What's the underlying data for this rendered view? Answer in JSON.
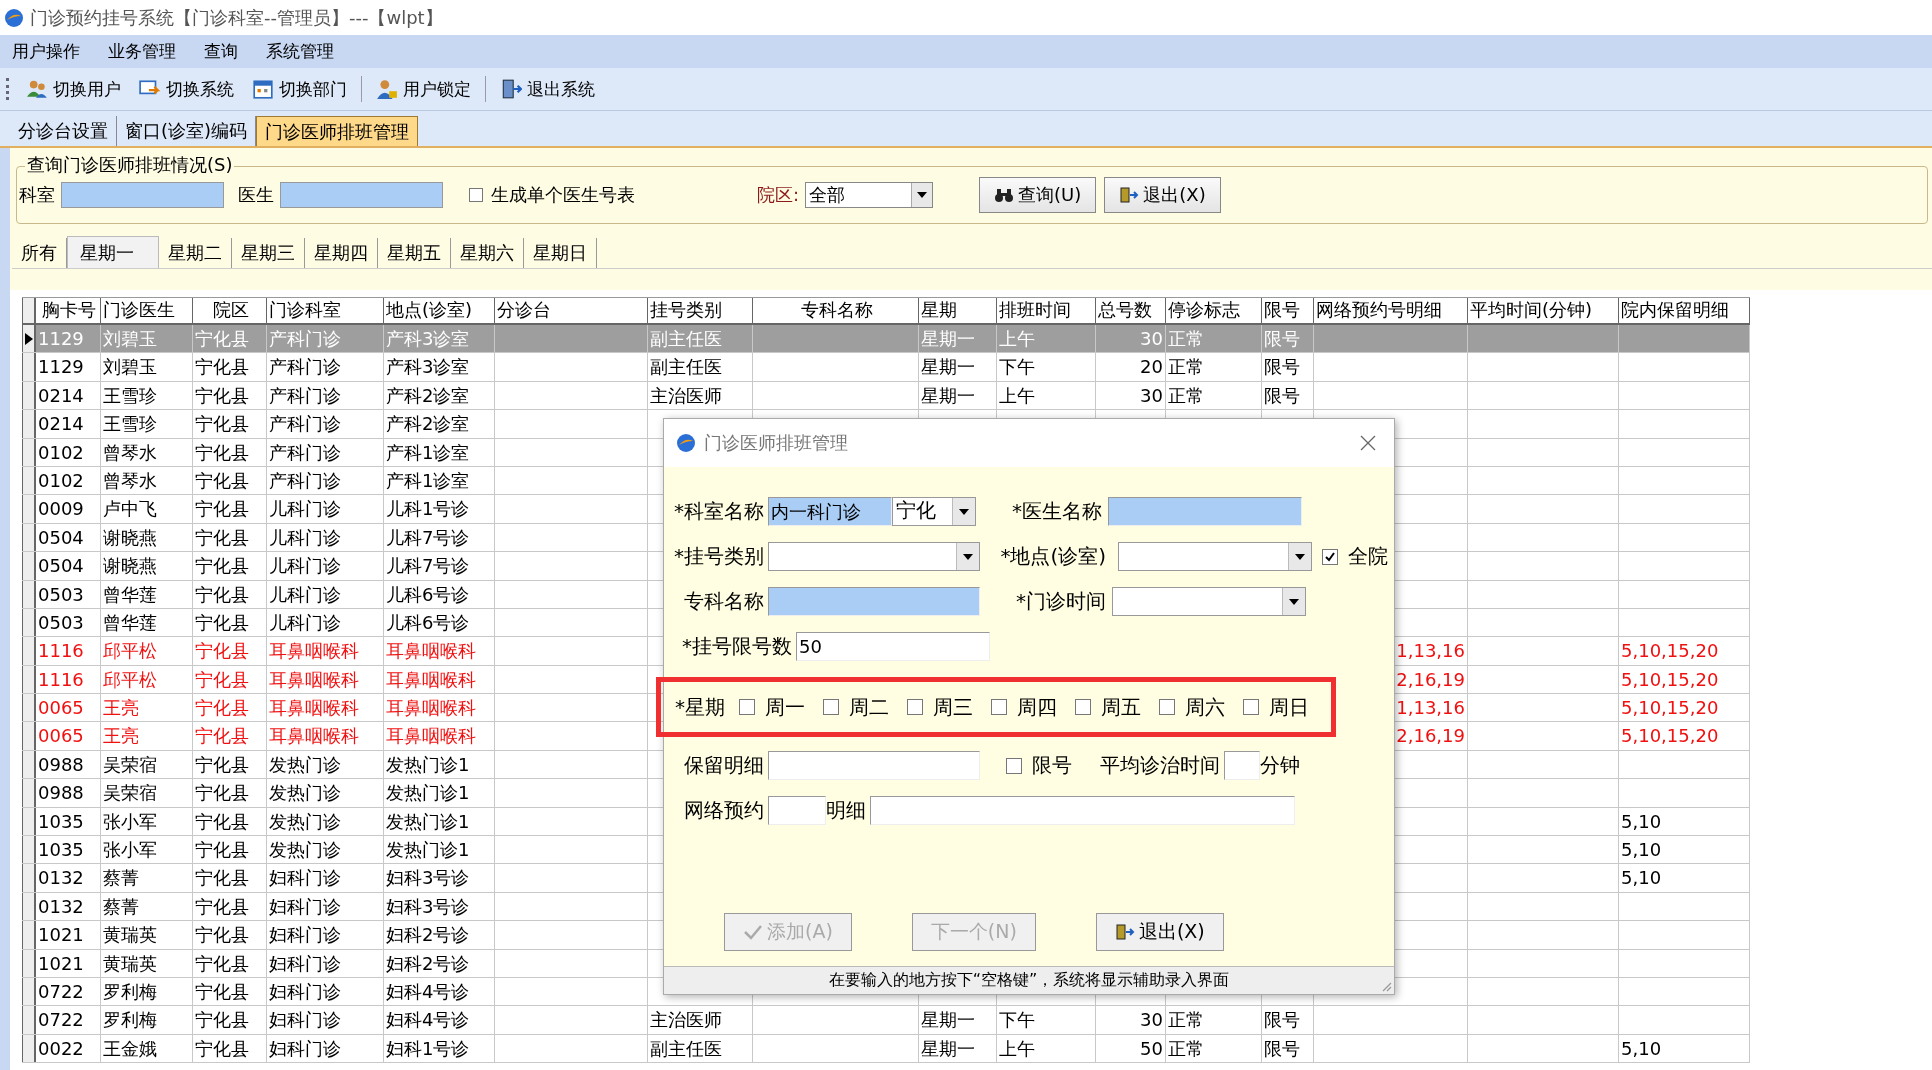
{
  "window": {
    "title": "门诊预约挂号系统【门诊科室--管理员】---【wlpt】"
  },
  "menu": [
    "用户操作",
    "业务管理",
    "查询",
    "系统管理"
  ],
  "toolbar": [
    "切换用户",
    "切换系统",
    "切换部门",
    "用户锁定",
    "退出系统"
  ],
  "tabs": [
    {
      "label": "分诊台设置",
      "selected": false
    },
    {
      "label": "窗口(诊室)编码",
      "selected": false
    },
    {
      "label": "门诊医师排班管理",
      "selected": true
    }
  ],
  "query": {
    "title": "查询门诊医师排班情况(S)",
    "dept_label": "科室",
    "doctor_label": "医生",
    "single": {
      "label": "生成单个医生号表",
      "checked": false
    },
    "campus_label": "院区:",
    "campus_value": "全部",
    "buttons": [
      "查询(U)",
      "退出(X)"
    ]
  },
  "day_tabs": [
    {
      "label": "所有",
      "selected": false
    },
    {
      "label": "星期一",
      "selected": true
    },
    {
      "label": "星期二",
      "selected": false
    },
    {
      "label": "星期三",
      "selected": false
    },
    {
      "label": "星期四",
      "selected": false
    },
    {
      "label": "星期五",
      "selected": false
    },
    {
      "label": "星期六",
      "selected": false
    },
    {
      "label": "星期日",
      "selected": false
    }
  ],
  "table": {
    "columns": [
      "胸卡号",
      "门诊医生",
      "院区",
      "门诊科室",
      "地点(诊室)",
      "分诊台",
      "挂号类别",
      "专科名称",
      "星期",
      "排班时间",
      "总号数",
      "停诊标志",
      "限号",
      "网络预约号明细",
      "平均时间(分钟)",
      "院内保留明细"
    ],
    "rows": [
      {
        "selected": true,
        "alert": false,
        "card": "1129",
        "doctor": "刘碧玉",
        "campus": "宁化县",
        "dept": "产科门诊",
        "location": "产科3诊室",
        "reg_type": "副主任医",
        "weekday": "星期一",
        "shift": "上午",
        "total": "30",
        "status": "正常",
        "limit": "限号"
      },
      {
        "selected": false,
        "alert": false,
        "card": "1129",
        "doctor": "刘碧玉",
        "campus": "宁化县",
        "dept": "产科门诊",
        "location": "产科3诊室",
        "reg_type": "副主任医",
        "weekday": "星期一",
        "shift": "下午",
        "total": "20",
        "status": "正常",
        "limit": "限号"
      },
      {
        "selected": false,
        "alert": false,
        "card": "0214",
        "doctor": "王雪珍",
        "campus": "宁化县",
        "dept": "产科门诊",
        "location": "产科2诊室",
        "reg_type": "主治医师",
        "weekday": "星期一",
        "shift": "上午",
        "total": "30",
        "status": "正常",
        "limit": "限号"
      },
      {
        "selected": false,
        "alert": false,
        "card": "0214",
        "doctor": "王雪珍",
        "campus": "宁化县",
        "dept": "产科门诊",
        "location": "产科2诊室"
      },
      {
        "selected": false,
        "alert": false,
        "card": "0102",
        "doctor": "曾琴水",
        "campus": "宁化县",
        "dept": "产科门诊",
        "location": "产科1诊室"
      },
      {
        "selected": false,
        "alert": false,
        "card": "0102",
        "doctor": "曾琴水",
        "campus": "宁化县",
        "dept": "产科门诊",
        "location": "产科1诊室"
      },
      {
        "selected": false,
        "alert": false,
        "card": "0009",
        "doctor": "卢中飞",
        "campus": "宁化县",
        "dept": "儿科门诊",
        "location": "儿科1号诊"
      },
      {
        "selected": false,
        "alert": false,
        "card": "0504",
        "doctor": "谢晓燕",
        "campus": "宁化县",
        "dept": "儿科门诊",
        "location": "儿科7号诊"
      },
      {
        "selected": false,
        "alert": false,
        "card": "0504",
        "doctor": "谢晓燕",
        "campus": "宁化县",
        "dept": "儿科门诊",
        "location": "儿科7号诊"
      },
      {
        "selected": false,
        "alert": false,
        "card": "0503",
        "doctor": "曾华莲",
        "campus": "宁化县",
        "dept": "儿科门诊",
        "location": "儿科6号诊"
      },
      {
        "selected": false,
        "alert": false,
        "card": "0503",
        "doctor": "曾华莲",
        "campus": "宁化县",
        "dept": "儿科门诊",
        "location": "儿科6号诊"
      },
      {
        "selected": false,
        "alert": true,
        "card": "1116",
        "doctor": "邱平松",
        "campus": "宁化县",
        "dept": "耳鼻咽喉科",
        "location": "耳鼻咽喉科",
        "net_detail": "1,13,16",
        "reserve": "5,10,15,20"
      },
      {
        "selected": false,
        "alert": true,
        "card": "1116",
        "doctor": "邱平松",
        "campus": "宁化县",
        "dept": "耳鼻咽喉科",
        "location": "耳鼻咽喉科",
        "net_detail": "2,16,19",
        "reserve": "5,10,15,20"
      },
      {
        "selected": false,
        "alert": true,
        "card": "0065",
        "doctor": "王亮",
        "campus": "宁化县",
        "dept": "耳鼻咽喉科",
        "location": "耳鼻咽喉科",
        "net_detail": "1,13,16",
        "reserve": "5,10,15,20"
      },
      {
        "selected": false,
        "alert": true,
        "card": "0065",
        "doctor": "王亮",
        "campus": "宁化县",
        "dept": "耳鼻咽喉科",
        "location": "耳鼻咽喉科",
        "net_detail": "2,16,19",
        "reserve": "5,10,15,20"
      },
      {
        "selected": false,
        "alert": false,
        "card": "0988",
        "doctor": "吴荣宿",
        "campus": "宁化县",
        "dept": "发热门诊",
        "location": "发热门诊1"
      },
      {
        "selected": false,
        "alert": false,
        "card": "0988",
        "doctor": "吴荣宿",
        "campus": "宁化县",
        "dept": "发热门诊",
        "location": "发热门诊1"
      },
      {
        "selected": false,
        "alert": false,
        "card": "1035",
        "doctor": "张小军",
        "campus": "宁化县",
        "dept": "发热门诊",
        "location": "发热门诊1",
        "reserve": "5,10"
      },
      {
        "selected": false,
        "alert": false,
        "card": "1035",
        "doctor": "张小军",
        "campus": "宁化县",
        "dept": "发热门诊",
        "location": "发热门诊1",
        "reserve": "5,10"
      },
      {
        "selected": false,
        "alert": false,
        "card": "0132",
        "doctor": "蔡菁",
        "campus": "宁化县",
        "dept": "妇科门诊",
        "location": "妇科3号诊",
        "reserve": "5,10"
      },
      {
        "selected": false,
        "alert": false,
        "card": "0132",
        "doctor": "蔡菁",
        "campus": "宁化县",
        "dept": "妇科门诊",
        "location": "妇科3号诊"
      },
      {
        "selected": false,
        "alert": false,
        "card": "1021",
        "doctor": "黄瑞英",
        "campus": "宁化县",
        "dept": "妇科门诊",
        "location": "妇科2号诊"
      },
      {
        "selected": false,
        "alert": false,
        "card": "1021",
        "doctor": "黄瑞英",
        "campus": "宁化县",
        "dept": "妇科门诊",
        "location": "妇科2号诊"
      },
      {
        "selected": false,
        "alert": false,
        "card": "0722",
        "doctor": "罗利梅",
        "campus": "宁化县",
        "dept": "妇科门诊",
        "location": "妇科4号诊"
      },
      {
        "selected": false,
        "alert": false,
        "card": "0722",
        "doctor": "罗利梅",
        "campus": "宁化县",
        "dept": "妇科门诊",
        "location": "妇科4号诊",
        "reg_type": "主治医师",
        "weekday": "星期一",
        "shift": "下午",
        "total": "30",
        "status": "正常",
        "limit": "限号"
      },
      {
        "selected": false,
        "alert": false,
        "card": "0022",
        "doctor": "王金娥",
        "campus": "宁化县",
        "dept": "妇科门诊",
        "location": "妇科1号诊",
        "reg_type": "副主任医",
        "weekday": "星期一",
        "shift": "上午",
        "total": "50",
        "status": "正常",
        "limit": "限号",
        "reserve": "5,10"
      }
    ]
  },
  "dialog": {
    "title": "门诊医师排班管理",
    "dept": {
      "label": "*科室名称",
      "value": "内一科门诊"
    },
    "campus": {
      "value": "宁化"
    },
    "doctor": {
      "label": "*医生名称"
    },
    "reg_type": {
      "label": "*挂号类别"
    },
    "location": {
      "label": "*地点(诊室)"
    },
    "whole": {
      "label": "全院",
      "checked": true
    },
    "specialty": {
      "label": "专科名称"
    },
    "clinic_time": {
      "label": "*门诊时间"
    },
    "quota": {
      "label": "*挂号限号数",
      "value": "50"
    },
    "weekdays": {
      "label": "*星期",
      "options": [
        {
          "label": "周一",
          "checked": false
        },
        {
          "label": "周二",
          "checked": false
        },
        {
          "label": "周三",
          "checked": false
        },
        {
          "label": "周四",
          "checked": false
        },
        {
          "label": "周五",
          "checked": false
        },
        {
          "label": "周六",
          "checked": false
        },
        {
          "label": "周日",
          "checked": false
        }
      ]
    },
    "reserve": {
      "label": "保留明细"
    },
    "limit": {
      "label": "限号",
      "checked": false
    },
    "avg_time": {
      "label": "平均诊治时间",
      "unit": "分钟"
    },
    "online": {
      "label": "网络预约"
    },
    "online_detail": {
      "label": "明细"
    },
    "buttons": [
      {
        "label": "添加(A)",
        "disabled": true
      },
      {
        "label": "下一个(N)",
        "disabled": true
      },
      {
        "label": "退出(X)",
        "disabled": false
      }
    ],
    "status": "在要输入的地方按下“空格键”，系统将显示辅助录入界面"
  }
}
